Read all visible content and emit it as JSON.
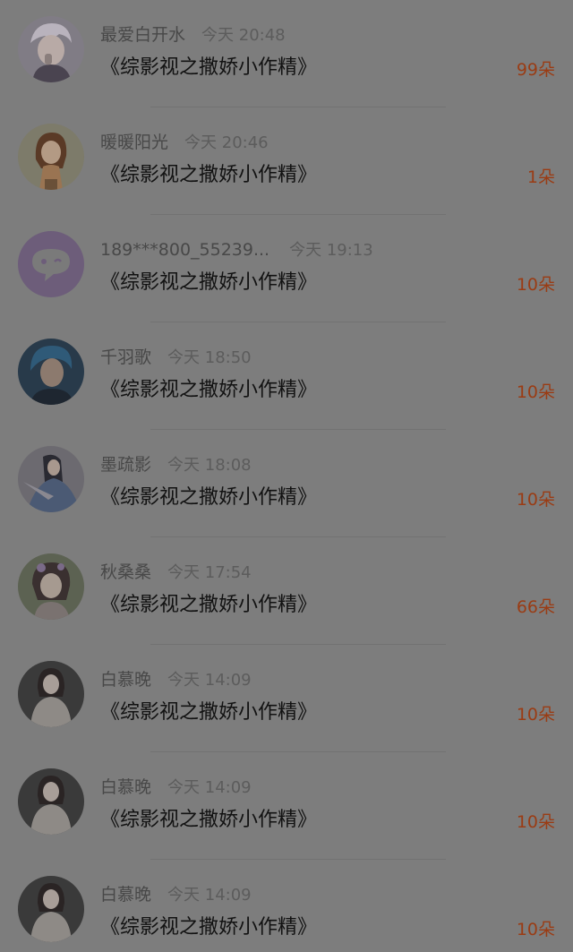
{
  "rows": [
    {
      "username": "最爱白开水",
      "time": "今天 20:48",
      "message": "《综影视之撒娇小作精》",
      "flowers": "99朵",
      "avatar_icon": "anime-boy-avatar-icon",
      "avatar_colors": [
        "#807c85",
        "#b9b3bd",
        "#4a4450"
      ]
    },
    {
      "username": "暖暖阳光",
      "time": "今天 20:46",
      "message": "《综影视之撒娇小作精》",
      "flowers": "1朵",
      "avatar_icon": "girl-illustration-avatar-icon",
      "avatar_colors": [
        "#7d7b6a",
        "#9a7452",
        "#5a3a26"
      ]
    },
    {
      "username": "189***800_55239...",
      "time": "今天 19:13",
      "message": "《综影视之撒娇小作精》",
      "flowers": "10朵",
      "avatar_icon": "chat-bubble-avatar-icon",
      "avatar_colors": [
        "#6d5d7a",
        "#6d5d7a",
        "#7a7a7a"
      ]
    },
    {
      "username": "千羽歌",
      "time": "今天 18:50",
      "message": "《综影视之撒娇小作精》",
      "flowers": "10朵",
      "avatar_icon": "blue-hair-boy-avatar-icon",
      "avatar_colors": [
        "#283a4a",
        "#2f5a78",
        "#8c7a6e"
      ]
    },
    {
      "username": "墨疏影",
      "time": "今天 18:08",
      "message": "《综影视之撒娇小作精》",
      "flowers": "10朵",
      "avatar_icon": "ancient-costume-avatar-icon",
      "avatar_colors": [
        "#6c6a70",
        "#4b5a74",
        "#2a2a32"
      ]
    },
    {
      "username": "秋桑桑",
      "time": "今天 17:54",
      "message": "《综影视之撒娇小作精》",
      "flowers": "66朵",
      "avatar_icon": "floral-hair-girl-avatar-icon",
      "avatar_colors": [
        "#5c6252",
        "#7a7270",
        "#3a3030"
      ]
    },
    {
      "username": "白慕晚",
      "time": "今天 14:09",
      "message": "《综影视之撒娇小作精》",
      "flowers": "10朵",
      "avatar_icon": "woman-portrait-avatar-icon",
      "avatar_colors": [
        "#3a3a3a",
        "#8e8a86",
        "#2a2424"
      ]
    },
    {
      "username": "白慕晚",
      "time": "今天 14:09",
      "message": "《综影视之撒娇小作精》",
      "flowers": "10朵",
      "avatar_icon": "woman-portrait-avatar-icon",
      "avatar_colors": [
        "#3a3a3a",
        "#8e8a86",
        "#2a2424"
      ]
    },
    {
      "username": "白慕晚",
      "time": "今天 14:09",
      "message": "《综影视之撒娇小作精》",
      "flowers": "10朵",
      "avatar_icon": "woman-portrait-avatar-icon",
      "avatar_colors": [
        "#3a3a3a",
        "#8e8a86",
        "#2a2424"
      ]
    }
  ],
  "colors": {
    "overlay_background": "#7d7d7d",
    "flower_count": "#9a3c14",
    "message_text": "#121212",
    "username_text": "#484848",
    "time_text": "#5c5c5c"
  }
}
